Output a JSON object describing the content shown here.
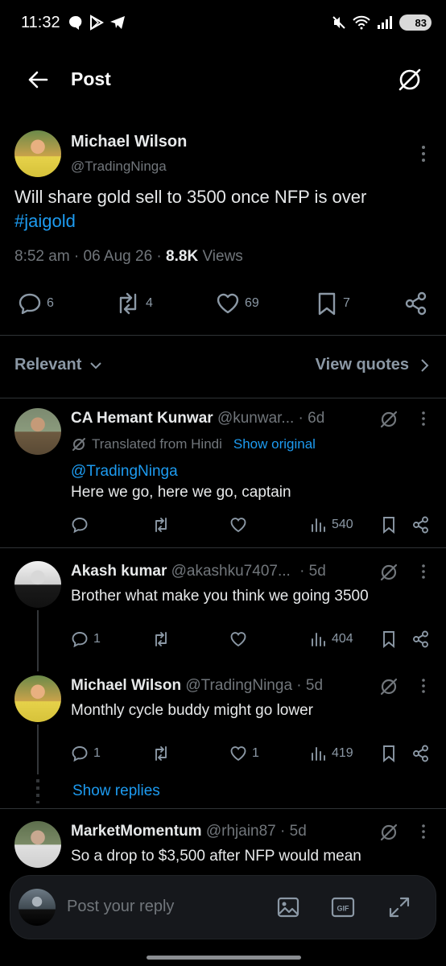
{
  "status_bar": {
    "time": "11:32",
    "battery": "83"
  },
  "header": {
    "title": "Post"
  },
  "post": {
    "author": "Michael Wilson",
    "handle": "@TradingNinga",
    "text": "Will share gold sell to 3500 once NFP is over",
    "hashtag": "#jaigold",
    "time": "8:52 am",
    "date": "06 Aug 26",
    "views_count": "8.8K",
    "views_label": "Views",
    "stats": {
      "replies": "6",
      "reposts": "4",
      "likes": "69",
      "bookmarks": "7"
    }
  },
  "sort": {
    "label": "Relevant",
    "quotes": "View quotes"
  },
  "replies": [
    {
      "author": "CA Hemant Kunwar",
      "handle": "@kunwar...",
      "age": "· 6d",
      "translated": "Translated from Hindi",
      "show_original": "Show original",
      "mention": "@TradingNinga",
      "text": "Here we go, here we go, captain",
      "views": "540"
    },
    {
      "author": "Akash kumar",
      "handle": "@akashku7407...",
      "age": "· 5d",
      "text": "Brother what make you think we going 3500",
      "replies": "1",
      "views": "404"
    },
    {
      "author": "Michael Wilson",
      "handle": "@TradingNinga",
      "age": "· 5d",
      "text": "Monthly cycle buddy might go lower",
      "replies": "1",
      "likes": "1",
      "views": "419"
    },
    {
      "author": "MarketMomentum",
      "handle": "@rhjain87",
      "age": "· 5d",
      "text": "So a drop to $3,500 after NFP would mean"
    }
  ],
  "show_replies": "Show replies",
  "composer": {
    "placeholder": "Post your reply"
  }
}
